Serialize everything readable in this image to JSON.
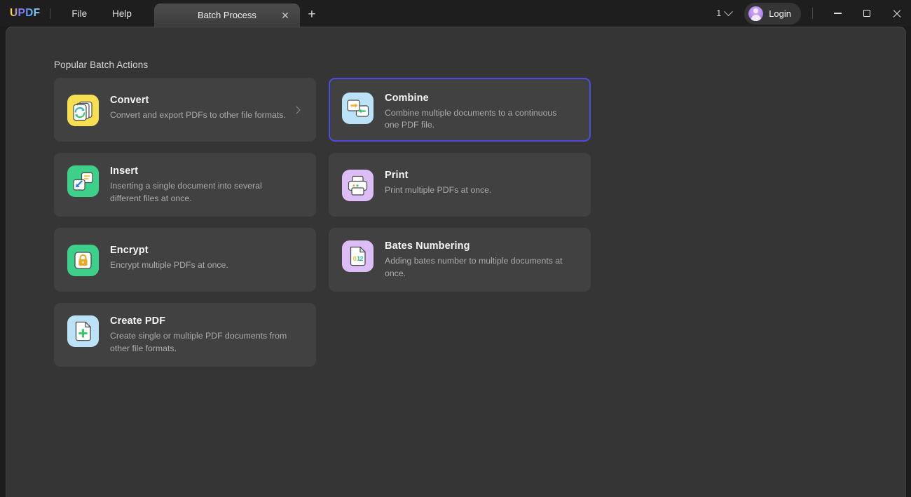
{
  "app": {
    "logo": "UPDF",
    "menus": [
      {
        "label": "File",
        "name": "menu-file"
      },
      {
        "label": "Help",
        "name": "menu-help"
      }
    ]
  },
  "tabs": [
    {
      "label": "Batch Process",
      "active": true
    }
  ],
  "tabbar": {
    "close_glyph": "✕",
    "new_tab_glyph": "+"
  },
  "titlebar_right": {
    "page_count": "1",
    "login_label": "Login",
    "window_controls": {
      "minimize": "minimize",
      "maximize": "maximize",
      "close": "close"
    }
  },
  "main": {
    "section_title": "Popular Batch Actions",
    "accent_color": "#4c4ce0",
    "background_color": "#353535",
    "card_color": "#414141",
    "cards": [
      {
        "id": "convert",
        "title": "Convert",
        "description": "Convert and export PDFs to other file formats.",
        "icon": "convert-icon",
        "icon_bg": "#f7df54",
        "selected": false,
        "has_arrow": true
      },
      {
        "id": "combine",
        "title": "Combine",
        "description": "Combine multiple documents to a continuous one PDF file.",
        "icon": "combine-icon",
        "icon_bg": "#bbe2f7",
        "selected": true,
        "has_arrow": false
      },
      {
        "id": "insert",
        "title": "Insert",
        "description": "Inserting a single document into several different files at once.",
        "icon": "insert-icon",
        "icon_bg": "#3ed08a",
        "selected": false,
        "has_arrow": false
      },
      {
        "id": "print",
        "title": "Print",
        "description": "Print multiple PDFs at once.",
        "icon": "print-icon",
        "icon_bg": "#ddbdf5",
        "selected": false,
        "has_arrow": false
      },
      {
        "id": "encrypt",
        "title": "Encrypt",
        "description": "Encrypt multiple PDFs at once.",
        "icon": "encrypt-icon",
        "icon_bg": "#3ed08a",
        "selected": false,
        "has_arrow": false
      },
      {
        "id": "bates-numbering",
        "title": "Bates Numbering",
        "description": "Adding bates number to multiple documents at once.",
        "icon": "bates-numbering-icon",
        "icon_bg": "#ddbdf5",
        "selected": false,
        "has_arrow": false,
        "icon_text": "012"
      },
      {
        "id": "create-pdf",
        "title": "Create PDF",
        "description": "Create single or multiple PDF documents from other file formats.",
        "icon": "create-pdf-icon",
        "icon_bg": "#bbe2f7",
        "selected": false,
        "has_arrow": false
      }
    ]
  }
}
